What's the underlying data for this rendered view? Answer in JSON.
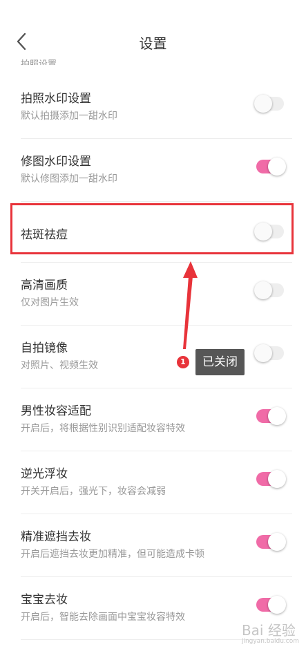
{
  "header": {
    "title": "设置",
    "back_icon": "chevron-left-icon"
  },
  "partial_section_label": "拍照设置",
  "rows": [
    {
      "name": "拍照水印设置",
      "desc": "默认拍摄添加一甜水印",
      "on": false
    },
    {
      "name": "修图水印设置",
      "desc": "默认修图添加一甜水印",
      "on": true
    },
    {
      "name": "祛斑祛痘",
      "desc": "",
      "on": false
    },
    {
      "name": "高清画质",
      "desc": "仅对图片生效",
      "on": false
    },
    {
      "name": "自拍镜像",
      "desc": "对照片、视频生效",
      "on": false
    },
    {
      "name": "男性妆容适配",
      "desc": "开启后，将根据性别识别适配妆容特效",
      "on": true
    },
    {
      "name": "逆光浮妆",
      "desc": "开关开启后，强光下，妆容会减弱",
      "on": true
    },
    {
      "name": "精准遮挡去妆",
      "desc": "开启后遮挡去妆更加精准，但可能造成卡顿",
      "on": true
    },
    {
      "name": "宝宝去妆",
      "desc": "开启后，智能去除画面中宝宝妆容特效",
      "on": true
    }
  ],
  "annotation": {
    "badge": "1",
    "label": "已关闭"
  },
  "colors": {
    "toggle_on": "#f06ba7",
    "toggle_off": "#eeeeee",
    "annotation_red": "#e8333a"
  },
  "watermark": {
    "main": "Bai 经验",
    "sub": "jingyan.baidu.com"
  }
}
